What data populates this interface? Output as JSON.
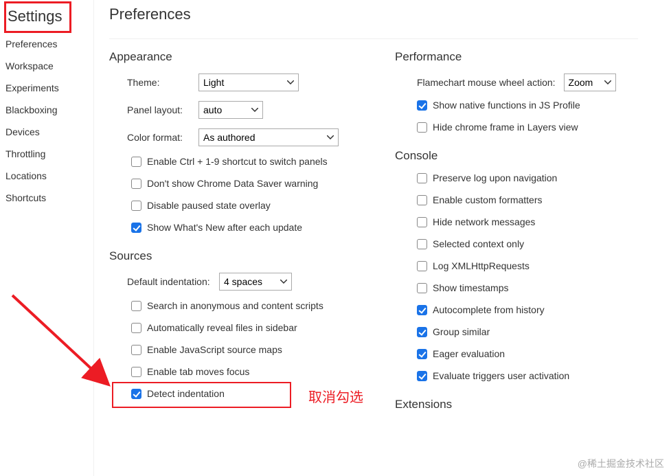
{
  "sidebar": {
    "title": "Settings",
    "items": [
      {
        "label": "Preferences"
      },
      {
        "label": "Workspace"
      },
      {
        "label": "Experiments"
      },
      {
        "label": "Blackboxing"
      },
      {
        "label": "Devices"
      },
      {
        "label": "Throttling"
      },
      {
        "label": "Locations"
      },
      {
        "label": "Shortcuts"
      }
    ]
  },
  "page": {
    "title": "Preferences"
  },
  "appearance": {
    "title": "Appearance",
    "theme_label": "Theme:",
    "theme_value": "Light",
    "panel_label": "Panel layout:",
    "panel_value": "auto",
    "color_label": "Color format:",
    "color_value": "As authored",
    "checks": [
      {
        "label": "Enable Ctrl + 1-9 shortcut to switch panels",
        "checked": false
      },
      {
        "label": "Don't show Chrome Data Saver warning",
        "checked": false
      },
      {
        "label": "Disable paused state overlay",
        "checked": false
      },
      {
        "label": "Show What's New after each update",
        "checked": true
      }
    ]
  },
  "sources": {
    "title": "Sources",
    "indent_label": "Default indentation:",
    "indent_value": "4 spaces",
    "checks": [
      {
        "label": "Search in anonymous and content scripts",
        "checked": false
      },
      {
        "label": "Automatically reveal files in sidebar",
        "checked": false
      },
      {
        "label": "Enable JavaScript source maps",
        "checked": false
      },
      {
        "label": "Enable tab moves focus",
        "checked": false
      },
      {
        "label": "Detect indentation",
        "checked": true
      }
    ]
  },
  "performance": {
    "title": "Performance",
    "wheel_label": "Flamechart mouse wheel action:",
    "wheel_value": "Zoom",
    "checks": [
      {
        "label": "Show native functions in JS Profile",
        "checked": true
      },
      {
        "label": "Hide chrome frame in Layers view",
        "checked": false
      }
    ]
  },
  "console": {
    "title": "Console",
    "checks": [
      {
        "label": "Preserve log upon navigation",
        "checked": false
      },
      {
        "label": "Enable custom formatters",
        "checked": false
      },
      {
        "label": "Hide network messages",
        "checked": false
      },
      {
        "label": "Selected context only",
        "checked": false
      },
      {
        "label": "Log XMLHttpRequests",
        "checked": false
      },
      {
        "label": "Show timestamps",
        "checked": false
      },
      {
        "label": "Autocomplete from history",
        "checked": true
      },
      {
        "label": "Group similar",
        "checked": true
      },
      {
        "label": "Eager evaluation",
        "checked": true
      },
      {
        "label": "Evaluate triggers user activation",
        "checked": true
      }
    ]
  },
  "extensions": {
    "title": "Extensions"
  },
  "annotation": {
    "text": "取消勾选",
    "watermark": "@稀土掘金技术社区"
  }
}
